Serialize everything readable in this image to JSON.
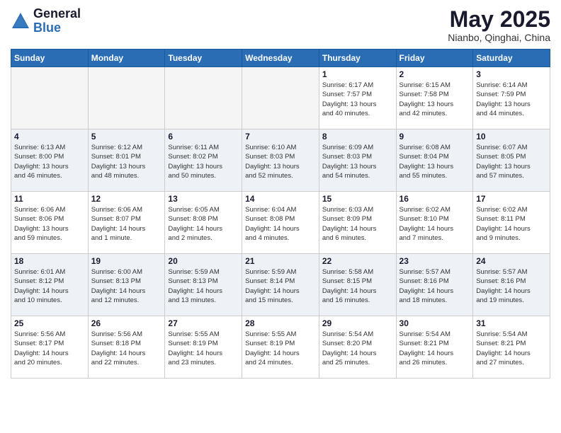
{
  "header": {
    "logo_general": "General",
    "logo_blue": "Blue",
    "month_title": "May 2025",
    "location": "Nianbo, Qinghai, China"
  },
  "weekdays": [
    "Sunday",
    "Monday",
    "Tuesday",
    "Wednesday",
    "Thursday",
    "Friday",
    "Saturday"
  ],
  "weeks": [
    [
      {
        "day": null,
        "info": null
      },
      {
        "day": null,
        "info": null
      },
      {
        "day": null,
        "info": null
      },
      {
        "day": null,
        "info": null
      },
      {
        "day": "1",
        "info": "Sunrise: 6:17 AM\nSunset: 7:57 PM\nDaylight: 13 hours\nand 40 minutes."
      },
      {
        "day": "2",
        "info": "Sunrise: 6:15 AM\nSunset: 7:58 PM\nDaylight: 13 hours\nand 42 minutes."
      },
      {
        "day": "3",
        "info": "Sunrise: 6:14 AM\nSunset: 7:59 PM\nDaylight: 13 hours\nand 44 minutes."
      }
    ],
    [
      {
        "day": "4",
        "info": "Sunrise: 6:13 AM\nSunset: 8:00 PM\nDaylight: 13 hours\nand 46 minutes."
      },
      {
        "day": "5",
        "info": "Sunrise: 6:12 AM\nSunset: 8:01 PM\nDaylight: 13 hours\nand 48 minutes."
      },
      {
        "day": "6",
        "info": "Sunrise: 6:11 AM\nSunset: 8:02 PM\nDaylight: 13 hours\nand 50 minutes."
      },
      {
        "day": "7",
        "info": "Sunrise: 6:10 AM\nSunset: 8:03 PM\nDaylight: 13 hours\nand 52 minutes."
      },
      {
        "day": "8",
        "info": "Sunrise: 6:09 AM\nSunset: 8:03 PM\nDaylight: 13 hours\nand 54 minutes."
      },
      {
        "day": "9",
        "info": "Sunrise: 6:08 AM\nSunset: 8:04 PM\nDaylight: 13 hours\nand 55 minutes."
      },
      {
        "day": "10",
        "info": "Sunrise: 6:07 AM\nSunset: 8:05 PM\nDaylight: 13 hours\nand 57 minutes."
      }
    ],
    [
      {
        "day": "11",
        "info": "Sunrise: 6:06 AM\nSunset: 8:06 PM\nDaylight: 13 hours\nand 59 minutes."
      },
      {
        "day": "12",
        "info": "Sunrise: 6:06 AM\nSunset: 8:07 PM\nDaylight: 14 hours\nand 1 minute."
      },
      {
        "day": "13",
        "info": "Sunrise: 6:05 AM\nSunset: 8:08 PM\nDaylight: 14 hours\nand 2 minutes."
      },
      {
        "day": "14",
        "info": "Sunrise: 6:04 AM\nSunset: 8:08 PM\nDaylight: 14 hours\nand 4 minutes."
      },
      {
        "day": "15",
        "info": "Sunrise: 6:03 AM\nSunset: 8:09 PM\nDaylight: 14 hours\nand 6 minutes."
      },
      {
        "day": "16",
        "info": "Sunrise: 6:02 AM\nSunset: 8:10 PM\nDaylight: 14 hours\nand 7 minutes."
      },
      {
        "day": "17",
        "info": "Sunrise: 6:02 AM\nSunset: 8:11 PM\nDaylight: 14 hours\nand 9 minutes."
      }
    ],
    [
      {
        "day": "18",
        "info": "Sunrise: 6:01 AM\nSunset: 8:12 PM\nDaylight: 14 hours\nand 10 minutes."
      },
      {
        "day": "19",
        "info": "Sunrise: 6:00 AM\nSunset: 8:13 PM\nDaylight: 14 hours\nand 12 minutes."
      },
      {
        "day": "20",
        "info": "Sunrise: 5:59 AM\nSunset: 8:13 PM\nDaylight: 14 hours\nand 13 minutes."
      },
      {
        "day": "21",
        "info": "Sunrise: 5:59 AM\nSunset: 8:14 PM\nDaylight: 14 hours\nand 15 minutes."
      },
      {
        "day": "22",
        "info": "Sunrise: 5:58 AM\nSunset: 8:15 PM\nDaylight: 14 hours\nand 16 minutes."
      },
      {
        "day": "23",
        "info": "Sunrise: 5:57 AM\nSunset: 8:16 PM\nDaylight: 14 hours\nand 18 minutes."
      },
      {
        "day": "24",
        "info": "Sunrise: 5:57 AM\nSunset: 8:16 PM\nDaylight: 14 hours\nand 19 minutes."
      }
    ],
    [
      {
        "day": "25",
        "info": "Sunrise: 5:56 AM\nSunset: 8:17 PM\nDaylight: 14 hours\nand 20 minutes."
      },
      {
        "day": "26",
        "info": "Sunrise: 5:56 AM\nSunset: 8:18 PM\nDaylight: 14 hours\nand 22 minutes."
      },
      {
        "day": "27",
        "info": "Sunrise: 5:55 AM\nSunset: 8:19 PM\nDaylight: 14 hours\nand 23 minutes."
      },
      {
        "day": "28",
        "info": "Sunrise: 5:55 AM\nSunset: 8:19 PM\nDaylight: 14 hours\nand 24 minutes."
      },
      {
        "day": "29",
        "info": "Sunrise: 5:54 AM\nSunset: 8:20 PM\nDaylight: 14 hours\nand 25 minutes."
      },
      {
        "day": "30",
        "info": "Sunrise: 5:54 AM\nSunset: 8:21 PM\nDaylight: 14 hours\nand 26 minutes."
      },
      {
        "day": "31",
        "info": "Sunrise: 5:54 AM\nSunset: 8:21 PM\nDaylight: 14 hours\nand 27 minutes."
      }
    ]
  ]
}
